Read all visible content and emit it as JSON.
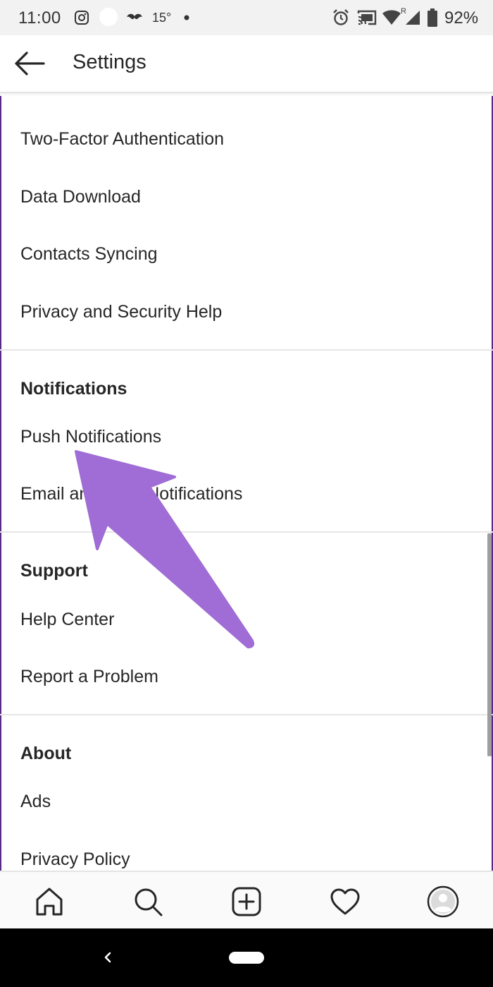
{
  "status_bar": {
    "time": "11:00",
    "temperature": "15°",
    "battery": "92%"
  },
  "header": {
    "title": "Settings"
  },
  "sections": {
    "security_items": [
      "Two-Factor Authentication",
      "Data Download",
      "Contacts Syncing",
      "Privacy and Security Help"
    ],
    "notifications": {
      "title": "Notifications",
      "items": [
        "Push Notifications",
        "Email and SMS Notifications"
      ]
    },
    "support": {
      "title": "Support",
      "items": [
        "Help Center",
        "Report a Problem"
      ]
    },
    "about": {
      "title": "About",
      "items": [
        "Ads",
        "Privacy Policy"
      ]
    }
  },
  "bottom_nav": {
    "items": [
      "home-icon",
      "search-icon",
      "add-post-icon",
      "activity-heart-icon",
      "profile-icon"
    ]
  },
  "colors": {
    "arrow": "#a06cd5",
    "text": "#262626",
    "divider": "#e6e6e6"
  }
}
